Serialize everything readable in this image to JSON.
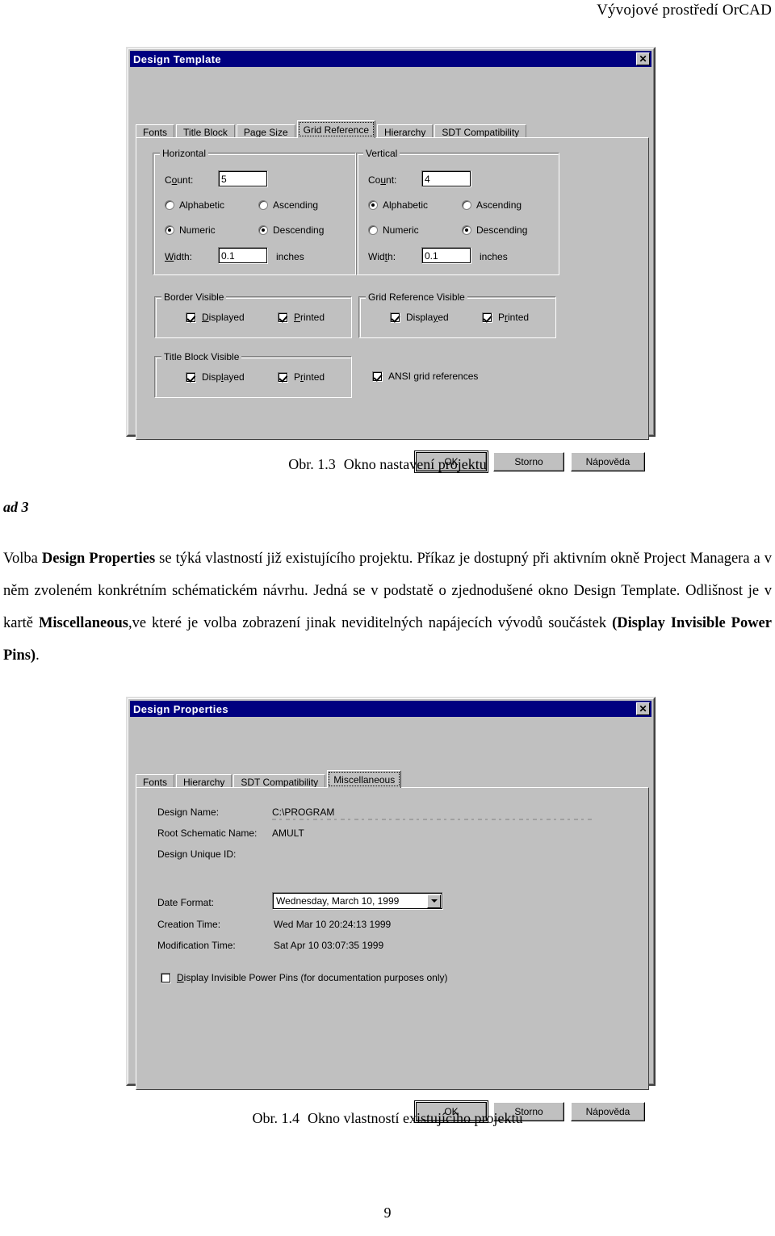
{
  "page": {
    "running_head": "Vývojové prostředí OrCAD",
    "page_number": "9"
  },
  "figure1": {
    "caption_number": "Obr. 1.3",
    "caption_text": "Okno nastavení projektu",
    "dialog": {
      "title": "Design Template",
      "close_label": "✕",
      "tabs": [
        {
          "label": "Fonts",
          "active": false
        },
        {
          "label": "Title Block",
          "active": false
        },
        {
          "label": "Page Size",
          "active": false
        },
        {
          "label": "Grid Reference",
          "active": true
        },
        {
          "label": "Hierarchy",
          "active": false
        },
        {
          "label": "SDT Compatibility",
          "active": false
        }
      ],
      "horizontal": {
        "group_title": "Horizontal",
        "count_label": "Count:",
        "count_value": "5",
        "alphabetic_label": "Alphabetic",
        "alphabetic_selected": false,
        "ascending_label": "Ascending",
        "ascending_selected": false,
        "numeric_label": "Numeric",
        "numeric_selected": true,
        "descending_label": "Descending",
        "descending_selected": true,
        "width_label": "Width:",
        "width_value": "0.1",
        "width_units": "inches"
      },
      "vertical": {
        "group_title": "Vertical",
        "count_label": "Count:",
        "count_value": "4",
        "alphabetic_label": "Alphabetic",
        "alphabetic_selected": true,
        "ascending_label": "Ascending",
        "ascending_selected": false,
        "numeric_label": "Numeric",
        "numeric_selected": false,
        "descending_label": "Descending",
        "descending_selected": true,
        "width_label": "Width:",
        "width_value": "0.1",
        "width_units": "inches"
      },
      "border_visible": {
        "group_title": "Border Visible",
        "displayed_label": "Displayed",
        "displayed_checked": true,
        "printed_label": "Printed",
        "printed_checked": true
      },
      "grid_reference_visible": {
        "group_title": "Grid Reference Visible",
        "displayed_label": "Displayed",
        "displayed_checked": true,
        "printed_label": "Printed",
        "printed_checked": true
      },
      "title_block_visible": {
        "group_title": "Title Block Visible",
        "displayed_label": "Displayed",
        "displayed_checked": true,
        "printed_label": "Printed",
        "printed_checked": true
      },
      "ansi_grid": {
        "label": "ANSI grid references",
        "checked": true
      },
      "buttons": {
        "ok": "OK",
        "cancel": "Storno",
        "help": "Nápověda"
      }
    }
  },
  "body": {
    "ad_label": "ad 3",
    "paragraph": {
      "p1": "Volba ",
      "b1": "Design Properties",
      "p2": " se týká vlastností již existujícího projektu. Příkaz je dostupný při aktivním okně Project Managera a v něm zvoleném konkrétním schématickém návrhu. Jedná se v podstatě o zjednodušené okno Design Template. Odlišnost je v kartě ",
      "b2": "Miscellaneous",
      "p3": ",ve které je volba  zobrazení jinak neviditelných napájecích vývodů součástek ",
      "b3": "(Display Invisible Power Pins)",
      "p4": "."
    }
  },
  "figure2": {
    "caption_number": "Obr. 1.4",
    "caption_text": "Okno vlastností existujícího projektu",
    "dialog": {
      "title": "Design Properties",
      "close_label": "✕",
      "tabs": [
        {
          "label": "Fonts",
          "active": false
        },
        {
          "label": "Hierarchy",
          "active": false
        },
        {
          "label": "SDT Compatibility",
          "active": false
        },
        {
          "label": "Miscellaneous",
          "active": true
        }
      ],
      "fields": [
        {
          "label": "Design Name:",
          "value": "C:\\PROGRAM"
        },
        {
          "label": "Root Schematic Name:",
          "value": "AMULT"
        },
        {
          "label": "Design Unique ID:",
          "value": ""
        }
      ],
      "date_format": {
        "label": "Date Format:",
        "value": "Wednesday, March 10, 1999"
      },
      "creation_time": {
        "label": "Creation Time:",
        "value": "Wed Mar 10 20:24:13 1999"
      },
      "modification_time": {
        "label": "Modification Time:",
        "value": "Sat Apr 10 03:07:35 1999"
      },
      "power_pins": {
        "label": "Display Invisible Power Pins (for documentation purposes only)",
        "checked": false
      },
      "buttons": {
        "ok": "OK",
        "cancel": "Storno",
        "help": "Nápověda"
      }
    }
  }
}
